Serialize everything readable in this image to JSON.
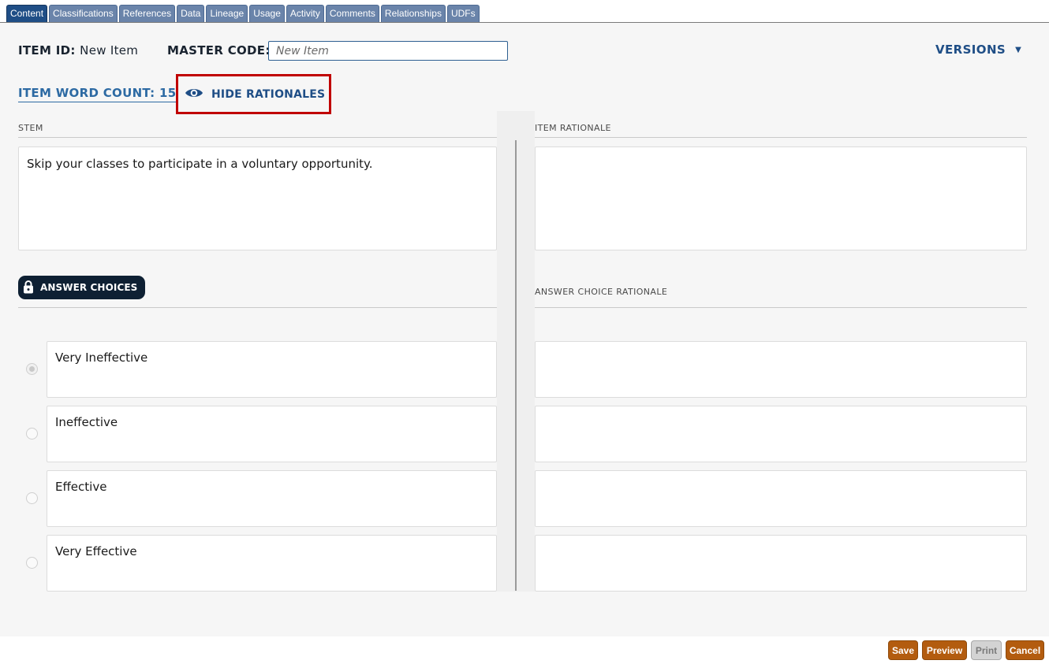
{
  "tabs": [
    {
      "label": "Content",
      "active": true
    },
    {
      "label": "Classifications"
    },
    {
      "label": "References"
    },
    {
      "label": "Data"
    },
    {
      "label": "Lineage"
    },
    {
      "label": "Usage"
    },
    {
      "label": "Activity"
    },
    {
      "label": "Comments"
    },
    {
      "label": "Relationships"
    },
    {
      "label": "UDFs"
    }
  ],
  "header": {
    "item_id_label": "ITEM ID:",
    "item_id_value": "New Item",
    "master_code_label": "MASTER CODE:",
    "master_code_placeholder": "New Item",
    "master_code_value": "",
    "versions_label": "VERSIONS",
    "versions_caret": "▼"
  },
  "toolbar": {
    "word_count_label": "ITEM WORD COUNT: 15",
    "hide_rationales_label": "HIDE RATIONALES"
  },
  "stem": {
    "label": "STEM",
    "text": "Skip your classes to participate in a voluntary opportunity."
  },
  "item_rationale": {
    "label": "ITEM RATIONALE",
    "text": ""
  },
  "answer_choices": {
    "chip_label": "ANSWER CHOICES",
    "rationale_label": "ANSWER CHOICE RATIONALE",
    "choices": [
      {
        "text": "Very Ineffective",
        "selected": true,
        "rationale": ""
      },
      {
        "text": "Ineffective",
        "selected": false,
        "rationale": ""
      },
      {
        "text": "Effective",
        "selected": false,
        "rationale": ""
      },
      {
        "text": "Very Effective",
        "selected": false,
        "rationale": ""
      }
    ]
  },
  "footer": {
    "save_label": "Save",
    "preview_label": "Preview",
    "print_label": "Print",
    "cancel_label": "Cancel"
  },
  "colors": {
    "accent": "#1f4e86",
    "button": "#b35c0f",
    "highlight_border": "#c00000",
    "chip_bg": "#0e2033"
  }
}
